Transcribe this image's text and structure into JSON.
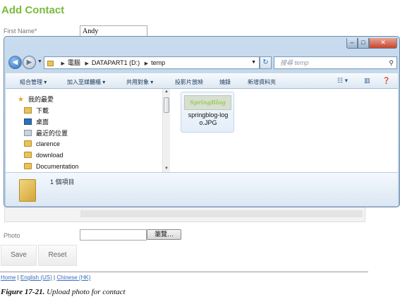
{
  "form": {
    "title": "Add Contact",
    "first_name_label": "First Name*",
    "first_name_value": "Andy",
    "photo_label": "Photo",
    "photo_value": "",
    "browse_label": "瀏覽…",
    "save_label": "Save",
    "reset_label": "Reset"
  },
  "footer": {
    "links": [
      "Home",
      "English (US)",
      "Chinese (HK)"
    ],
    "separator": "|"
  },
  "caption": {
    "number": "Figure 17-21.",
    "text": "Upload photo for contact"
  },
  "dialog": {
    "address": {
      "segments": [
        "電腦",
        "DATAPART1 (D:)",
        "temp"
      ]
    },
    "search_placeholder": "搜尋 temp",
    "toolbar": {
      "organize": "組合管理",
      "add_to_library": "加入至媒體櫃",
      "share": "共用對象",
      "slideshow": "投影片放映",
      "burn": "燒錄",
      "new_folder": "新增資料夾"
    },
    "nav_items": [
      {
        "label": "我的最愛",
        "icon": "star-icon"
      },
      {
        "label": "下載",
        "icon": "download-folder-icon"
      },
      {
        "label": "桌面",
        "icon": "desktop-icon"
      },
      {
        "label": "最近的位置",
        "icon": "recent-places-icon"
      },
      {
        "label": "clarence",
        "icon": "folder-icon"
      },
      {
        "label": "download",
        "icon": "folder-icon"
      },
      {
        "label": "Documentation",
        "icon": "folder-icon"
      }
    ],
    "file": {
      "thumbnail_text": "SpringBlog",
      "name": "springblog-logo.JPG",
      "name_line1": "springblog-log",
      "name_line2": "o.JPG"
    },
    "details": {
      "item_count": "1 個項目"
    }
  },
  "colors": {
    "title_green": "#7aba3a",
    "link_blue": "#3a6ec0",
    "dialog_frame": "#b6cde4"
  }
}
